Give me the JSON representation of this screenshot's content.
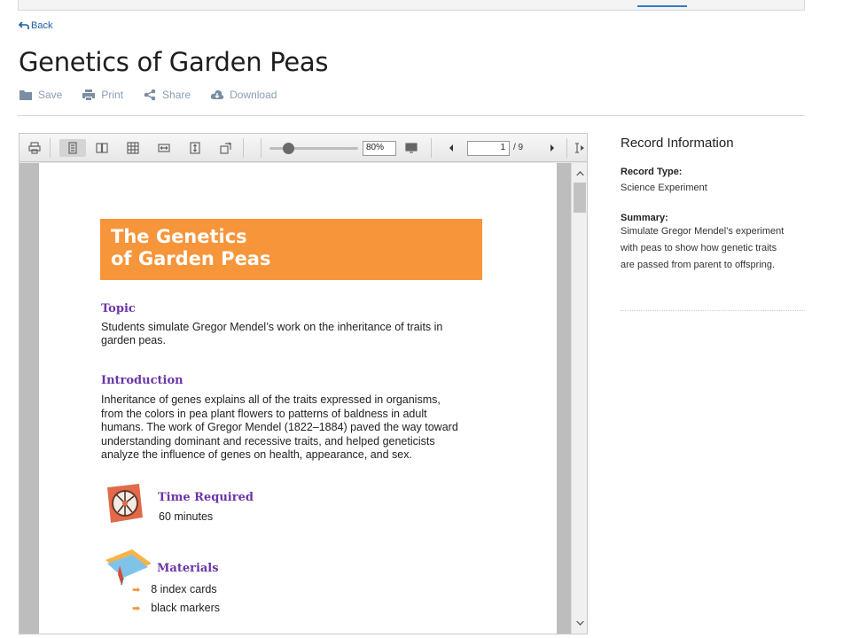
{
  "nav": {
    "back_label": "Back"
  },
  "page": {
    "title": "Genetics of Garden Peas"
  },
  "actions": [
    {
      "label": "Save",
      "icon": "folder-icon"
    },
    {
      "label": "Print",
      "icon": "printer-icon"
    },
    {
      "label": "Share",
      "icon": "share-icon"
    },
    {
      "label": "Download",
      "icon": "cloud-download-icon"
    }
  ],
  "viewer": {
    "zoom": "80%",
    "current_page": "1",
    "total_pages": "/ 9",
    "zoom_slider_value": 0.2
  },
  "document": {
    "banner_line1": "The Genetics",
    "banner_line2": "of Garden Peas",
    "banner_color": "#f7953a",
    "heading_color": "#6b35a6",
    "topic_heading": "Topic",
    "topic_line1": "Students simulate Gregor Mendel’s work on the inheritance of traits in",
    "topic_line2": "garden peas.",
    "intro_heading": "Introduction",
    "intro_lines": [
      "Inheritance of genes explains all of the traits expressed in organisms,",
      "from the colors in pea plant flowers to patterns of baldness in adult",
      "humans. The work of Gregor Mendel (1822–1884) paved the way toward",
      "understanding dominant and recessive traits, and helped geneticists",
      "analyze the influence of genes on health, appearance, and sex."
    ],
    "time_heading": "Time Required",
    "time_value": "60 minutes",
    "materials_heading": "Materials",
    "materials": [
      "8 index cards",
      "black markers"
    ]
  },
  "record": {
    "title": "Record Information",
    "type_label": "Record Type:",
    "type_value": "Science Experiment",
    "summary_label": "Summary:",
    "summary_lines": [
      "Simulate Gregor Mendel's experiment",
      "with peas to show how genetic traits",
      "are passed from parent to offspring."
    ]
  }
}
